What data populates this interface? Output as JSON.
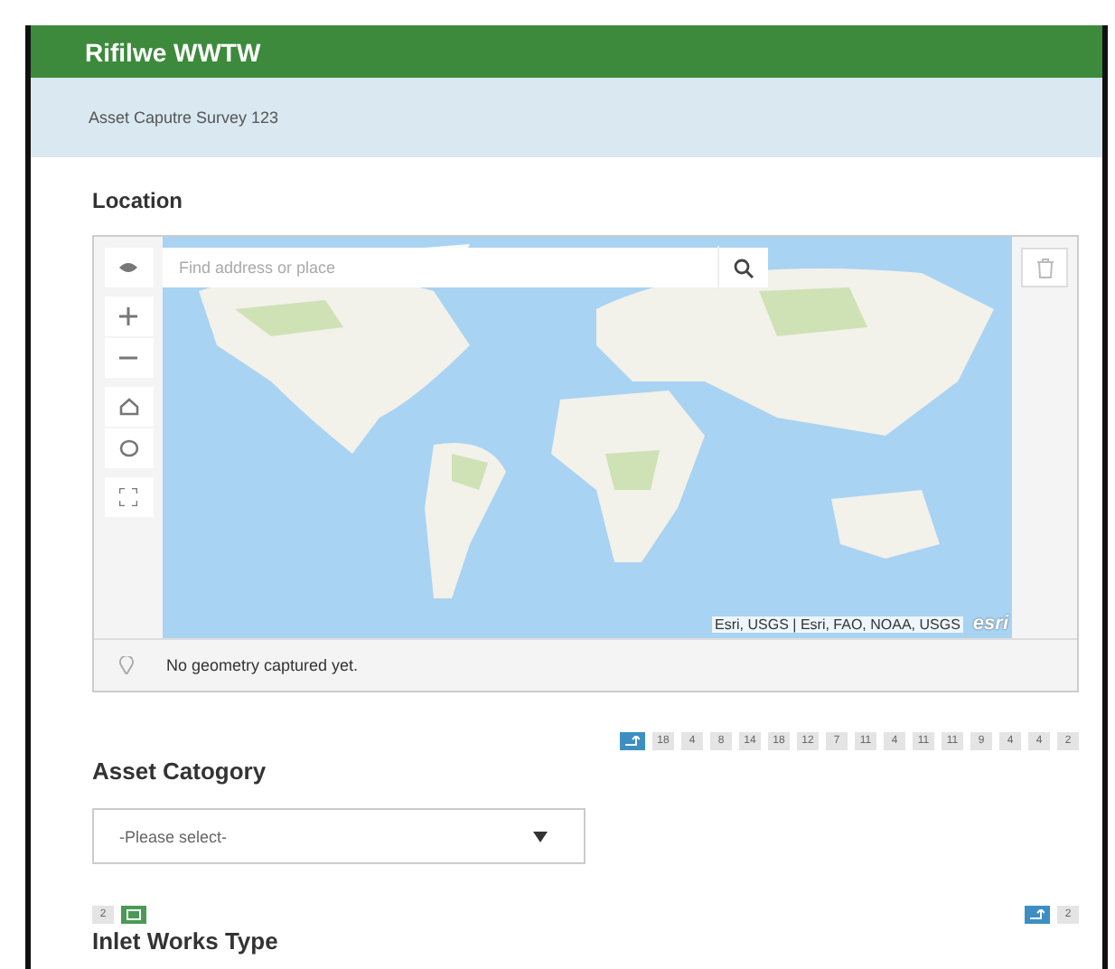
{
  "header": {
    "title": "Rifilwe WWTW"
  },
  "subtitle": "Asset Caputre Survey 123",
  "location": {
    "label": "Location",
    "search": {
      "placeholder": "Find address or place"
    },
    "attribution": "Esri, USGS | Esri, FAO, NOAA, USGS",
    "logo": "esri",
    "status": "No geometry captured yet."
  },
  "badge_row": [
    {
      "kind": "icon",
      "color": "#3d8fc2"
    },
    {
      "kind": "count",
      "text": "18"
    },
    {
      "kind": "count",
      "text": "4"
    },
    {
      "kind": "count",
      "text": "8"
    },
    {
      "kind": "count",
      "text": "14"
    },
    {
      "kind": "count",
      "text": "18"
    },
    {
      "kind": "count",
      "text": "12"
    },
    {
      "kind": "count",
      "text": "7"
    },
    {
      "kind": "count",
      "text": "11"
    },
    {
      "kind": "count",
      "text": "4"
    },
    {
      "kind": "count",
      "text": "11"
    },
    {
      "kind": "count",
      "text": "11"
    },
    {
      "kind": "count",
      "text": "9"
    },
    {
      "kind": "count",
      "text": "4"
    },
    {
      "kind": "count",
      "text": "4"
    },
    {
      "kind": "count",
      "text": "2"
    }
  ],
  "asset_category": {
    "label": "Asset Catogory",
    "select": {
      "value": "-Please select-"
    }
  },
  "inlet_badges_left": [
    {
      "kind": "count",
      "text": "2"
    },
    {
      "kind": "icon",
      "color": "#4a9a55"
    }
  ],
  "inlet_badges_right": [
    {
      "kind": "icon",
      "color": "#3d8fc2"
    },
    {
      "kind": "count",
      "text": "2"
    }
  ],
  "inlet_works": {
    "label": "Inlet Works Type"
  }
}
